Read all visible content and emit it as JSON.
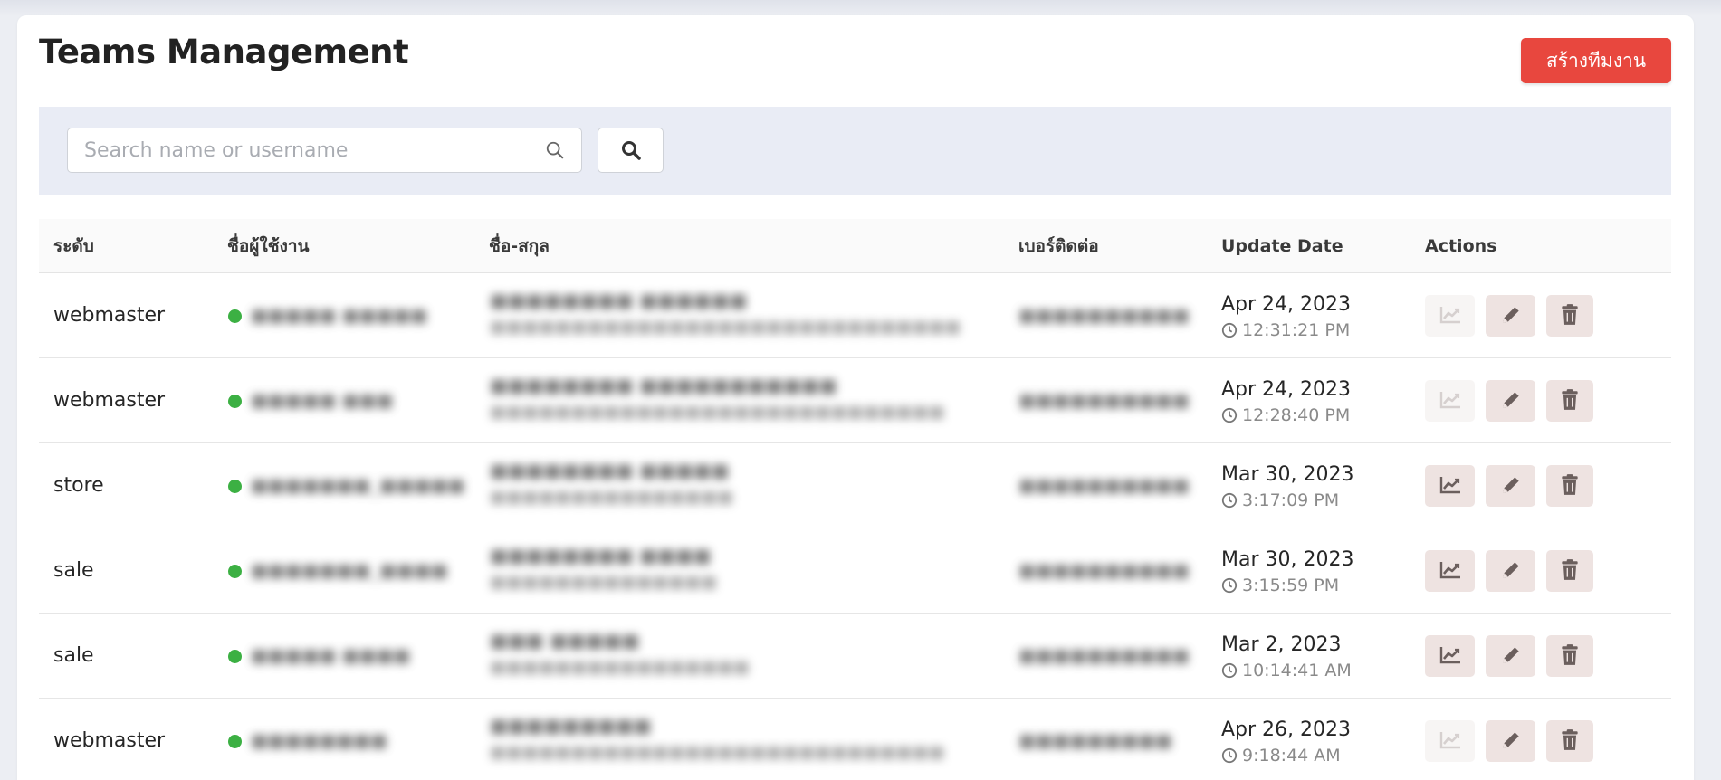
{
  "page": {
    "title": "Teams Management",
    "create_button_label": "สร้างทีมงาน"
  },
  "search": {
    "placeholder": "Search name or username",
    "value": ""
  },
  "colors": {
    "accent": "#e8473e",
    "status_online": "#3cb043",
    "action_bg": "#eee3e1",
    "filter_bg": "#e9ecf5"
  },
  "table": {
    "columns": [
      "ระดับ",
      "ชื่อผู้ใช้งาน",
      "ชื่อ-สกุล",
      "เบอร์ติดต่อ",
      "Update Date",
      "Actions"
    ],
    "rows": [
      {
        "level": "webmaster",
        "username": "■■■■■ ■■■■■",
        "fullname": "■■■■■■■■ ■■■■■■",
        "email": "■■■■■■■■■■■■■■■■■■■■■■■■■■■■■",
        "phone": "■■■■■■■■■■",
        "date": "Apr 24, 2023",
        "time": "12:31:21 PM",
        "stats_enabled": false
      },
      {
        "level": "webmaster",
        "username": "■■■■■ ■■■",
        "fullname": "■■■■■■■■ ■■■■■■■■■■■",
        "email": "■■■■■■■■■■■■■■■■■■■■■■■■■■■■",
        "phone": "■■■■■■■■■■",
        "date": "Apr 24, 2023",
        "time": "12:28:40 PM",
        "stats_enabled": false
      },
      {
        "level": "store",
        "username": "■■■■■■■_■■■■■",
        "fullname": "■■■■■■■■ ■■■■■",
        "email": "■■■■■■■■■■■■■■■",
        "phone": "■■■■■■■■■■",
        "date": "Mar 30, 2023",
        "time": "3:17:09 PM",
        "stats_enabled": true
      },
      {
        "level": "sale",
        "username": "■■■■■■■_■■■■",
        "fullname": "■■■■■■■■ ■■■■",
        "email": "■■■■■■■■■■■■■■",
        "phone": "■■■■■■■■■■",
        "date": "Mar 30, 2023",
        "time": "3:15:59 PM",
        "stats_enabled": true
      },
      {
        "level": "sale",
        "username": "■■■■■ ■■■■",
        "fullname": "■■■ ■■■■■",
        "email": "■■■■■■■■■■■■■■■■",
        "phone": "■■■■■■■■■■",
        "date": "Mar 2, 2023",
        "time": "10:14:41 AM",
        "stats_enabled": true
      },
      {
        "level": "webmaster",
        "username": "■■■■■■■■",
        "fullname": "■■■■■■■■■",
        "email": "■■■■■■■■■■■■■■■■■■■■■■■■■■■■",
        "phone": "■■■■■■■■■",
        "date": "Apr 26, 2023",
        "time": "9:18:44 AM",
        "stats_enabled": false
      }
    ]
  }
}
